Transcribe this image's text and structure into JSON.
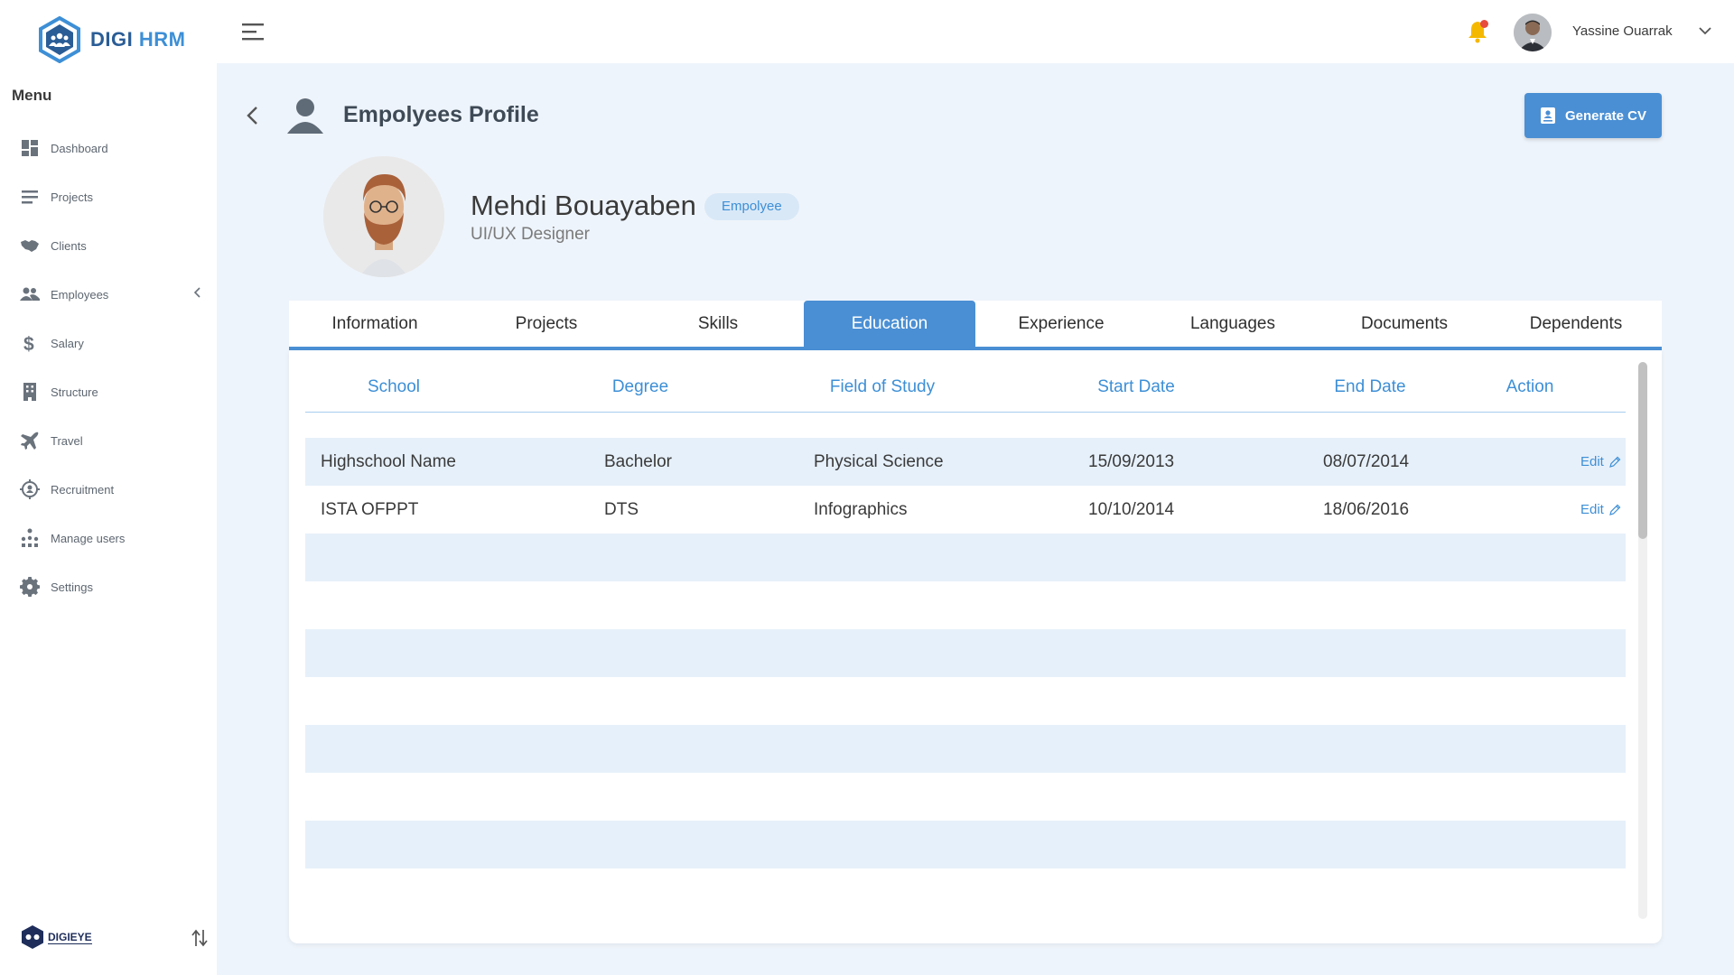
{
  "app": {
    "logo_main": "DIGI",
    "logo_accent": "HRM",
    "bottom_logo": "DIGIEYE"
  },
  "sidebar": {
    "menu_title": "Menu",
    "items": [
      {
        "label": "Dashboard",
        "icon": "dashboard-icon"
      },
      {
        "label": "Projects",
        "icon": "projects-icon"
      },
      {
        "label": "Clients",
        "icon": "handshake-icon"
      },
      {
        "label": "Employees",
        "icon": "users-icon",
        "has_submenu": true
      },
      {
        "label": "Salary",
        "icon": "dollar-icon"
      },
      {
        "label": "Structure",
        "icon": "building-icon"
      },
      {
        "label": "Travel",
        "icon": "plane-icon"
      },
      {
        "label": "Recruitment",
        "icon": "target-icon"
      },
      {
        "label": "Manage users",
        "icon": "sitemap-icon"
      },
      {
        "label": "Settings",
        "icon": "gear-icon"
      }
    ]
  },
  "topbar": {
    "user_name": "Yassine Ouarrak",
    "has_notification": true
  },
  "page": {
    "title": "Empolyees Profile",
    "generate_cv_label": "Generate CV"
  },
  "profile": {
    "name": "Mehdi Bouayaben",
    "badge": "Empolyee",
    "position": "UI/UX Designer"
  },
  "tabs": [
    {
      "label": "Information",
      "active": false
    },
    {
      "label": "Projects",
      "active": false
    },
    {
      "label": "Skills",
      "active": false
    },
    {
      "label": "Education",
      "active": true
    },
    {
      "label": "Experience",
      "active": false
    },
    {
      "label": "Languages",
      "active": false
    },
    {
      "label": "Documents",
      "active": false
    },
    {
      "label": "Dependents",
      "active": false
    }
  ],
  "education_table": {
    "headers": [
      "School",
      "Degree",
      "Field of Study",
      "Start Date",
      "End Date",
      "Action"
    ],
    "rows": [
      {
        "school": "Highschool Name",
        "degree": "Bachelor",
        "field": "Physical Science",
        "start": "15/09/2013",
        "end": "08/07/2014",
        "action": "Edit"
      },
      {
        "school": "ISTA OFPPT",
        "degree": "DTS",
        "field": "Infographics",
        "start": "10/10/2014",
        "end": "18/06/2016",
        "action": "Edit"
      }
    ]
  },
  "colors": {
    "primary": "#4a8fd4",
    "accent_text": "#3d8fd6",
    "row_shade": "#e6f0fa",
    "background": "#eef4fb",
    "notification": "#e74c3c",
    "bell": "#f5b800"
  }
}
